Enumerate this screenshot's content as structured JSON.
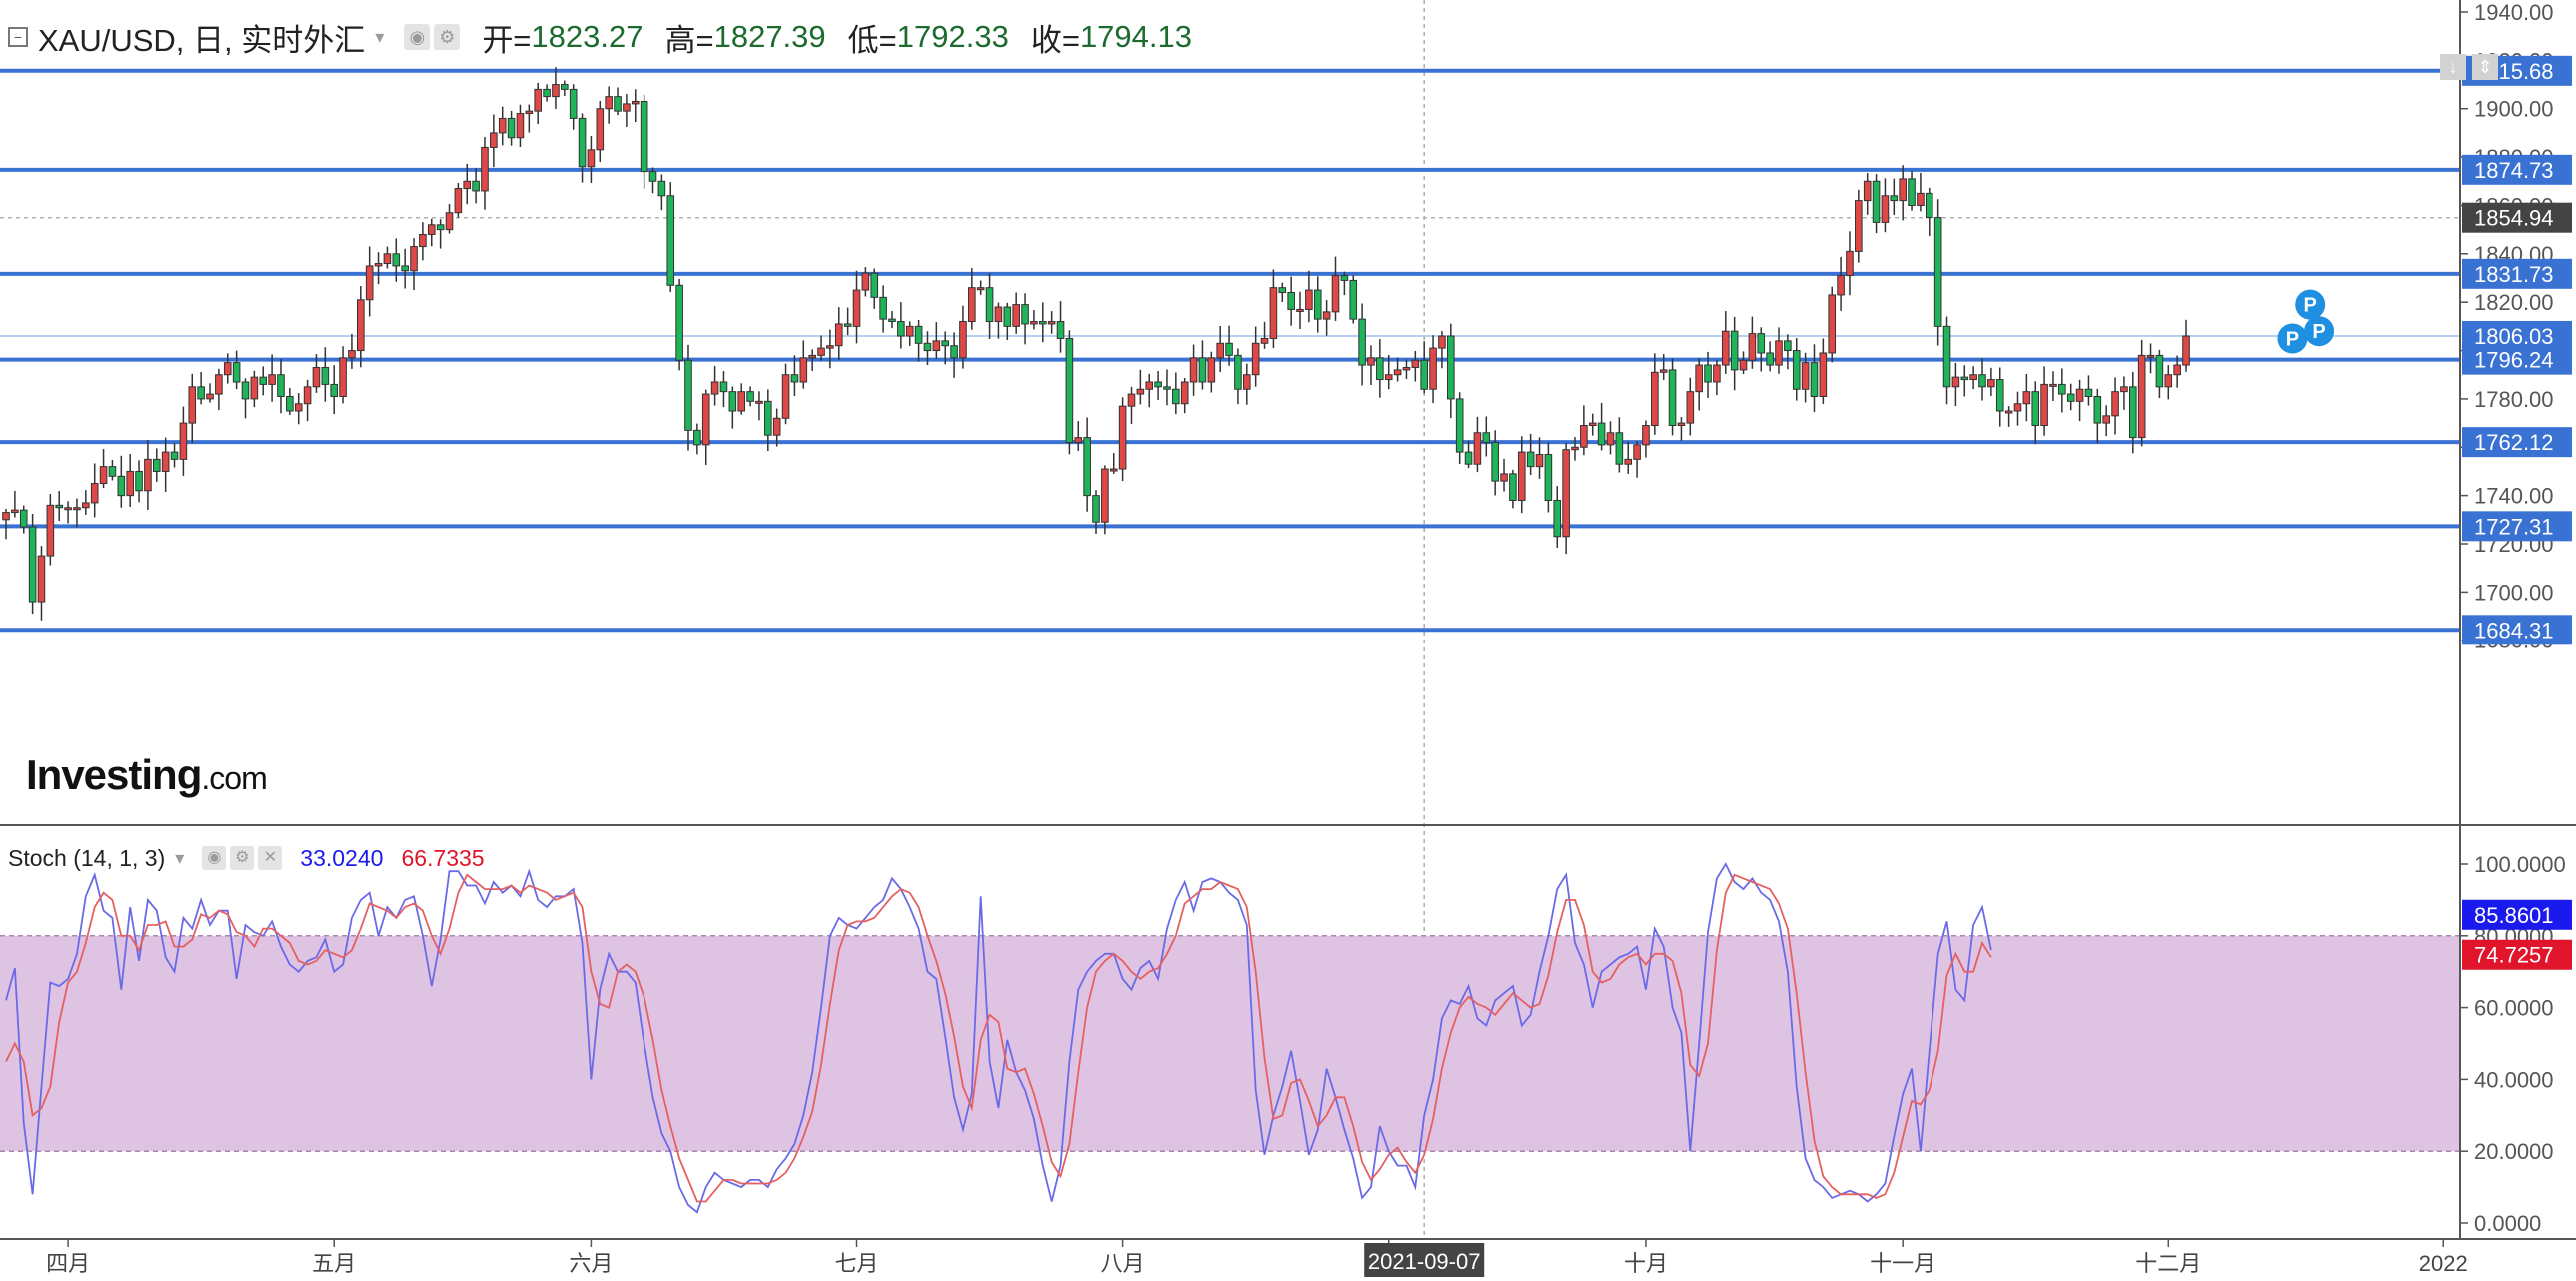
{
  "header": {
    "symbol": "XAU/USD, 日, 实时外汇",
    "open_label": "开=",
    "open": "1823.27",
    "high_label": "高=",
    "high": "1827.39",
    "low_label": "低=",
    "low": "1792.33",
    "close_label": "收=",
    "close": "1794.13"
  },
  "indicator": {
    "name": "Stoch (14, 1, 3)",
    "k_value": "33.0240",
    "d_value": "66.7335"
  },
  "logo": {
    "brand": "Investing",
    "suffix": ".com"
  },
  "colors": {
    "up": "#e04848",
    "down": "#1fb45a",
    "hline": "#3a72d4",
    "k_line": "#6a6ae8",
    "d_line": "#e56060",
    "band": "#dcbde0",
    "label_bg": "#3a72d4",
    "crosshair_label_bg": "#444444"
  },
  "chart_data": [
    {
      "type": "candlestick",
      "title": "XAU/USD",
      "y_ticks": [
        1680,
        1700,
        1720,
        1740,
        1760,
        1780,
        1800,
        1820,
        1840,
        1860,
        1880,
        1900,
        1920,
        1940
      ],
      "y_tick_labels": [
        "1680.00",
        "1700.00",
        "1720.00",
        "1740.00",
        "1760.00",
        "1780.00",
        "1800.00",
        "1820.00",
        "1840.00",
        "1860.00",
        "1880.00",
        "1900.00",
        "1920.00",
        "1940.00"
      ],
      "x_ticks": [
        {
          "i": 7,
          "label": "四月"
        },
        {
          "i": 37,
          "label": "五月"
        },
        {
          "i": 66,
          "label": "六月"
        },
        {
          "i": 96,
          "label": "七月"
        },
        {
          "i": 126,
          "label": "八月"
        },
        {
          "i": 156,
          "label": "九月"
        },
        {
          "i": 185,
          "label": "十月"
        },
        {
          "i": 214,
          "label": "十一月"
        },
        {
          "i": 244,
          "label": "十二月"
        },
        {
          "i": 275,
          "label": "2022"
        }
      ],
      "crosshair": {
        "i": 160,
        "date_label": "2021-09-07",
        "price": 1854.94,
        "price_label": "1854.94"
      },
      "horizontal_lines": [
        {
          "price": 1915.68,
          "label": "1915.68"
        },
        {
          "price": 1874.73,
          "label": "1874.73"
        },
        {
          "price": 1831.73,
          "label": "1831.73"
        },
        {
          "price": 1796.24,
          "label": "1796.24"
        },
        {
          "price": 1762.12,
          "label": "1762.12"
        },
        {
          "price": 1727.31,
          "label": "1727.31"
        },
        {
          "price": 1684.31,
          "label": "1684.31"
        }
      ],
      "current_price": {
        "price": 1806.03,
        "label": "1806.03"
      },
      "p_markers": [
        {
          "i": 258,
          "price": 1805
        },
        {
          "i": 260,
          "price": 1819
        },
        {
          "i": 261,
          "price": 1808
        }
      ],
      "closes": [
        1733,
        1734,
        1727,
        1696,
        1715,
        1736,
        1735,
        1735,
        1735,
        1737,
        1745,
        1752,
        1748,
        1740,
        1750,
        1742,
        1755,
        1750,
        1758,
        1755,
        1770,
        1785,
        1780,
        1782,
        1790,
        1795,
        1787,
        1780,
        1789,
        1786,
        1790,
        1781,
        1775,
        1778,
        1785,
        1793,
        1786,
        1781,
        1797,
        1800,
        1821,
        1835,
        1836,
        1840,
        1835,
        1833,
        1843,
        1848,
        1852,
        1850,
        1857,
        1867,
        1870,
        1866,
        1884,
        1890,
        1896,
        1888,
        1898,
        1899,
        1908,
        1905,
        1910,
        1908,
        1896,
        1876,
        1883,
        1900,
        1905,
        1899,
        1902,
        1903,
        1874,
        1870,
        1864,
        1827,
        1796,
        1767,
        1761,
        1782,
        1787,
        1783,
        1775,
        1783,
        1779,
        1779,
        1765,
        1772,
        1790,
        1787,
        1797,
        1798,
        1801,
        1802,
        1811,
        1810,
        1825,
        1832,
        1822,
        1813,
        1812,
        1806,
        1810,
        1803,
        1800,
        1804,
        1802,
        1797,
        1812,
        1826,
        1826,
        1812,
        1818,
        1810,
        1819,
        1811,
        1812,
        1811,
        1812,
        1805,
        1762,
        1764,
        1740,
        1729,
        1751,
        1751,
        1777,
        1782,
        1784,
        1787,
        1785,
        1784,
        1778,
        1787,
        1797,
        1787,
        1797,
        1803,
        1798,
        1784,
        1790,
        1803,
        1805,
        1826,
        1824,
        1817,
        1817,
        1825,
        1813,
        1816,
        1831,
        1829,
        1813,
        1794,
        1797,
        1788,
        1790,
        1792,
        1793,
        1796,
        1784,
        1801,
        1806,
        1780,
        1758,
        1753,
        1766,
        1762,
        1746,
        1749,
        1738,
        1758,
        1752,
        1757,
        1738,
        1723,
        1759,
        1760,
        1769,
        1770,
        1761,
        1766,
        1753,
        1755,
        1761,
        1769,
        1791,
        1792,
        1769,
        1770,
        1783,
        1794,
        1787,
        1794,
        1808,
        1792,
        1796,
        1807,
        1799,
        1794,
        1804,
        1800,
        1784,
        1795,
        1781,
        1799,
        1823,
        1831,
        1841,
        1862,
        1870,
        1853,
        1864,
        1862,
        1871,
        1860,
        1865,
        1855,
        1810,
        1785,
        1789,
        1788,
        1790,
        1785,
        1788,
        1775,
        1775,
        1778,
        1783,
        1769,
        1786,
        1786,
        1782,
        1779,
        1784,
        1781,
        1770,
        1773,
        1783,
        1785,
        1764,
        1798,
        1798,
        1785,
        1790,
        1794,
        1806
      ]
    },
    {
      "type": "line",
      "title": "Stoch (14, 1, 3)",
      "y_ticks": [
        0,
        20,
        40,
        60,
        80,
        100
      ],
      "y_tick_labels": [
        "0.0000",
        "20.0000",
        "40.0000",
        "60.0000",
        "80.0000",
        "100.0000"
      ],
      "band": [
        20,
        80
      ],
      "series": [
        {
          "name": "%K",
          "last_label": "85.8601",
          "values": [
            62,
            71,
            28,
            8,
            38,
            67,
            66,
            68,
            75,
            91,
            97,
            87,
            85,
            65,
            88,
            73,
            90,
            87,
            74,
            70,
            85,
            82,
            90,
            83,
            87,
            87,
            68,
            83,
            81,
            80,
            84,
            77,
            72,
            70,
            73,
            74,
            79,
            70,
            72,
            85,
            90,
            92,
            80,
            88,
            85,
            90,
            91,
            80,
            66,
            79,
            98,
            98,
            94,
            94,
            89,
            95,
            92,
            94,
            91,
            98,
            90,
            88,
            91,
            91,
            93,
            78,
            40,
            65,
            75,
            70,
            70,
            67,
            50,
            35,
            25,
            20,
            10,
            5,
            3,
            10,
            14,
            12,
            11,
            10,
            12,
            12,
            10,
            15,
            18,
            22,
            30,
            42,
            60,
            80,
            85,
            83,
            82,
            85,
            88,
            90,
            96,
            93,
            88,
            82,
            70,
            68,
            52,
            35,
            26,
            36,
            91,
            45,
            32,
            51,
            42,
            37,
            29,
            16,
            6,
            16,
            45,
            65,
            70,
            73,
            75,
            75,
            68,
            65,
            71,
            73,
            68,
            82,
            90,
            95,
            87,
            95,
            96,
            95,
            92,
            90,
            83,
            37,
            19,
            30,
            38,
            48,
            34,
            19,
            26,
            43,
            35,
            26,
            18,
            7,
            10,
            27,
            20,
            16,
            16,
            10,
            30,
            40,
            57,
            62,
            61,
            66,
            57,
            55,
            62,
            64,
            66,
            55,
            58,
            70,
            80,
            93,
            97,
            78,
            72,
            60,
            70,
            72,
            74,
            75,
            77,
            65,
            82,
            77,
            60,
            53,
            20,
            50,
            81,
            96,
            100,
            95,
            93,
            96,
            92,
            90,
            84,
            70,
            38,
            18,
            12,
            10,
            7,
            8,
            9,
            8,
            6,
            8,
            11,
            24,
            36,
            43,
            20,
            48,
            75,
            84,
            65,
            62,
            83,
            88,
            76
          ]
        },
        {
          "name": "%D",
          "last_label": "74.7257",
          "values": [
            45,
            50,
            45,
            30,
            32,
            38,
            56,
            67,
            70,
            78,
            88,
            92,
            90,
            80,
            80,
            76,
            83,
            83,
            84,
            77,
            77,
            79,
            86,
            85,
            87,
            86,
            81,
            80,
            77,
            82,
            82,
            80,
            78,
            73,
            72,
            73,
            76,
            75,
            74,
            76,
            82,
            89,
            88,
            87,
            85,
            88,
            89,
            87,
            80,
            75,
            82,
            92,
            97,
            95,
            93,
            93,
            93,
            94,
            92,
            94,
            93,
            92,
            90,
            91,
            92,
            88,
            70,
            61,
            60,
            70,
            72,
            70,
            63,
            51,
            37,
            27,
            18,
            12,
            6,
            6,
            9,
            12,
            12,
            11,
            11,
            11,
            11,
            12,
            14,
            18,
            24,
            31,
            44,
            61,
            76,
            83,
            84,
            84,
            85,
            88,
            91,
            93,
            92,
            88,
            80,
            73,
            64,
            52,
            38,
            32,
            51,
            58,
            56,
            43,
            42,
            43,
            36,
            27,
            17,
            13,
            22,
            42,
            60,
            70,
            73,
            75,
            73,
            70,
            68,
            70,
            71,
            75,
            80,
            89,
            91,
            93,
            93,
            95,
            94,
            93,
            88,
            70,
            46,
            29,
            30,
            39,
            40,
            34,
            27,
            30,
            35,
            35,
            27,
            17,
            12,
            15,
            19,
            21,
            17,
            14,
            19,
            29,
            43,
            53,
            60,
            63,
            61,
            60,
            58,
            61,
            64,
            62,
            60,
            61,
            69,
            81,
            90,
            90,
            83,
            70,
            67,
            68,
            72,
            74,
            75,
            72,
            75,
            75,
            73,
            64,
            44,
            41,
            50,
            76,
            92,
            97,
            96,
            95,
            94,
            93,
            89,
            82,
            64,
            42,
            23,
            13,
            10,
            8,
            8,
            8,
            8,
            7,
            8,
            14,
            24,
            34,
            33,
            37,
            48,
            69,
            75,
            70,
            70,
            78,
            74
          ]
        }
      ]
    }
  ]
}
